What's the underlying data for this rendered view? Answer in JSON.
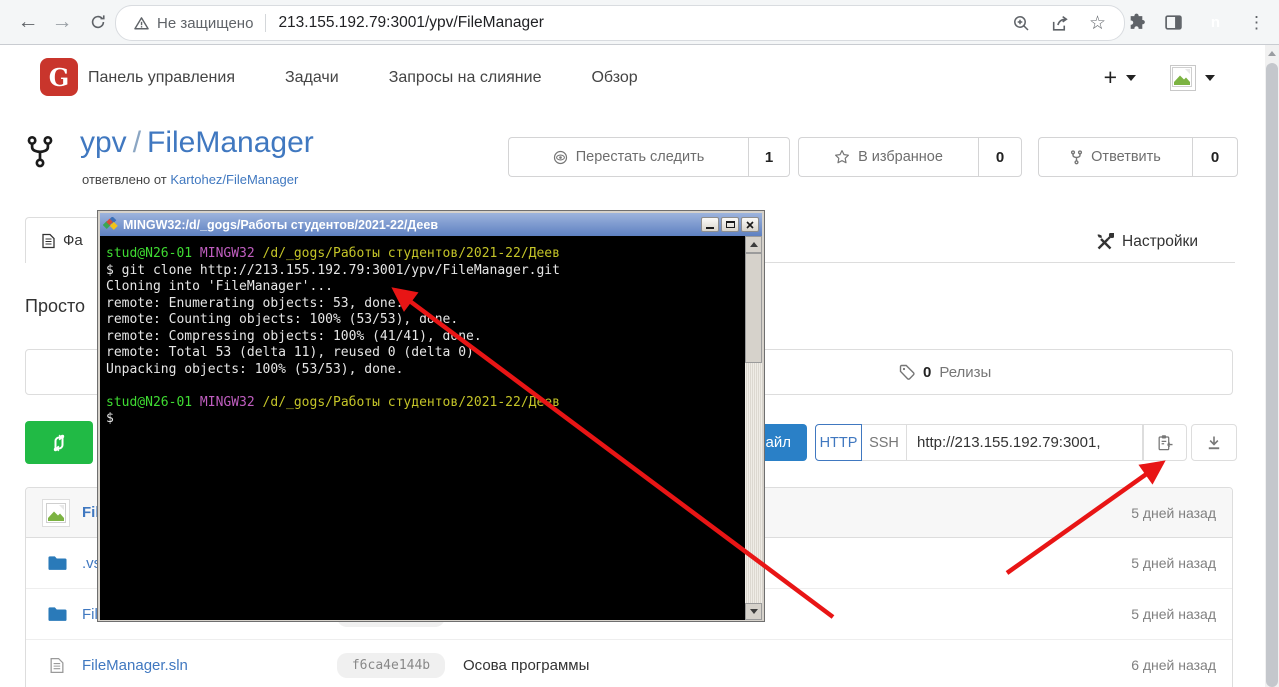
{
  "browser": {
    "security_label": "Не защищено",
    "url": "213.155.192.79:3001/ypv/FileManager",
    "profile_initial": "n",
    "profile_color": "#e8710a"
  },
  "nav": {
    "items": [
      "Панель управления",
      "Задачи",
      "Запросы на слияние",
      "Обзор"
    ],
    "add_label": "+"
  },
  "repo": {
    "owner": "ypv",
    "separator": "/",
    "name": "FileManager",
    "forked_from_label": "ответвлено от",
    "forked_from_link": "Kartohez/FileManager",
    "actions": [
      {
        "icon": "eye",
        "name": "unwatch",
        "label": "Перестать следить",
        "count": "1"
      },
      {
        "icon": "star",
        "name": "star",
        "label": "В избранное",
        "count": "0"
      },
      {
        "icon": "fork",
        "name": "fork",
        "label": "Ответвить",
        "count": "0"
      }
    ]
  },
  "tabs": {
    "files_label": "Фа",
    "settings_label": "Настройки"
  },
  "description": "Просто",
  "stats": {
    "releases_count": "0",
    "releases_label": "Релизы"
  },
  "clone": {
    "new_file_label": "файл",
    "http_label": "HTTP",
    "ssh_label": "SSH",
    "url_value": "http://213.155.192.79:3001,"
  },
  "terminal": {
    "title": "MINGW32:/d/_gogs/Работы студентов/2021-22/Деев",
    "lines": [
      [
        {
          "t": "stud@N26-01 ",
          "c": "green"
        },
        {
          "t": "MINGW32 ",
          "c": "magenta"
        },
        {
          "t": "/d/_gogs/Работы студентов/2021-22/Деев",
          "c": "yellow"
        }
      ],
      [
        {
          "t": "$ git clone http://213.155.192.79:3001/ypv/FileManager.git",
          "c": "fg"
        }
      ],
      [
        {
          "t": "Cloning into 'FileManager'...",
          "c": "fg"
        }
      ],
      [
        {
          "t": "remote: Enumerating objects: 53, done.",
          "c": "fg"
        }
      ],
      [
        {
          "t": "remote: Counting objects: 100% (53/53), done.",
          "c": "fg"
        }
      ],
      [
        {
          "t": "remote: Compressing objects: 100% (41/41), done.",
          "c": "fg"
        }
      ],
      [
        {
          "t": "remote: Total 53 (delta 11), reused 0 (delta 0)",
          "c": "fg"
        }
      ],
      [
        {
          "t": "Unpacking objects: 100% (53/53), done.",
          "c": "fg"
        }
      ],
      [
        {
          "t": "",
          "c": "fg"
        }
      ],
      [
        {
          "t": "stud@N26-01 ",
          "c": "green"
        },
        {
          "t": "MINGW32 ",
          "c": "magenta"
        },
        {
          "t": "/d/_gogs/Работы студентов/2021-22/Деев",
          "c": "yellow"
        }
      ],
      [
        {
          "t": "$",
          "c": "fg"
        }
      ]
    ]
  },
  "files": {
    "header": {
      "name": "Fil",
      "date": "5 дней назад"
    },
    "rows": [
      {
        "icon": "folder",
        "name": ".vs",
        "hash": null,
        "message": "",
        "date": "5 дней назад"
      },
      {
        "icon": "folder",
        "name": "File",
        "hash": "",
        "message": "",
        "date": "5 дней назад"
      },
      {
        "icon": "file",
        "name": "FileManager.sln",
        "hash": "f6ca4e144b",
        "message": "Осова программы",
        "date": "6 дней назад"
      }
    ]
  },
  "colors": {
    "link_blue": "#4078c0",
    "green_button": "#21ba45",
    "primary_blue": "#2a80c7",
    "arrow_red": "#e81515",
    "terminal_green": "#3fdb32",
    "terminal_magenta": "#c05ec0",
    "terminal_yellow": "#c4c428"
  }
}
